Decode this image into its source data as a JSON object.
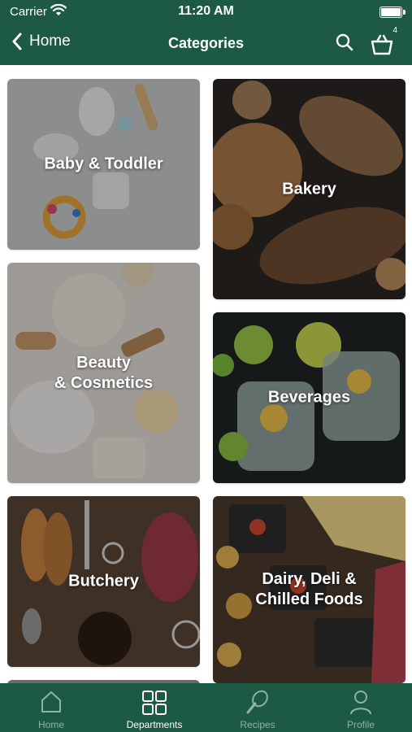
{
  "status_bar": {
    "carrier": "Carrier",
    "time": "11:20 AM"
  },
  "nav": {
    "back_label": "Home",
    "title": "Categories",
    "cart_count": "4",
    "search_icon": "search-icon",
    "cart_icon": "basket-icon"
  },
  "categories": [
    {
      "label": "Baby & Toddler",
      "palette": "light-grey"
    },
    {
      "label": "Bakery",
      "palette": "dark-bread"
    },
    {
      "label": "Beauty\n& Cosmetics",
      "palette": "cream"
    },
    {
      "label": "Beverages",
      "palette": "citrus-dark"
    },
    {
      "label": "Butchery",
      "palette": "wood-meat"
    },
    {
      "label": "Dairy, Deli &\nChilled Foods",
      "palette": "cheese"
    }
  ],
  "tabbar": {
    "items": [
      {
        "label": "Home",
        "icon": "home-icon",
        "active": false
      },
      {
        "label": "Departments",
        "icon": "grid-icon",
        "active": true
      },
      {
        "label": "Recipes",
        "icon": "whisk-icon",
        "active": false
      },
      {
        "label": "Profile",
        "icon": "person-icon",
        "active": false
      }
    ]
  },
  "colors": {
    "brand_green": "#1c5a43",
    "inactive_tab": "#8fb3a4"
  }
}
